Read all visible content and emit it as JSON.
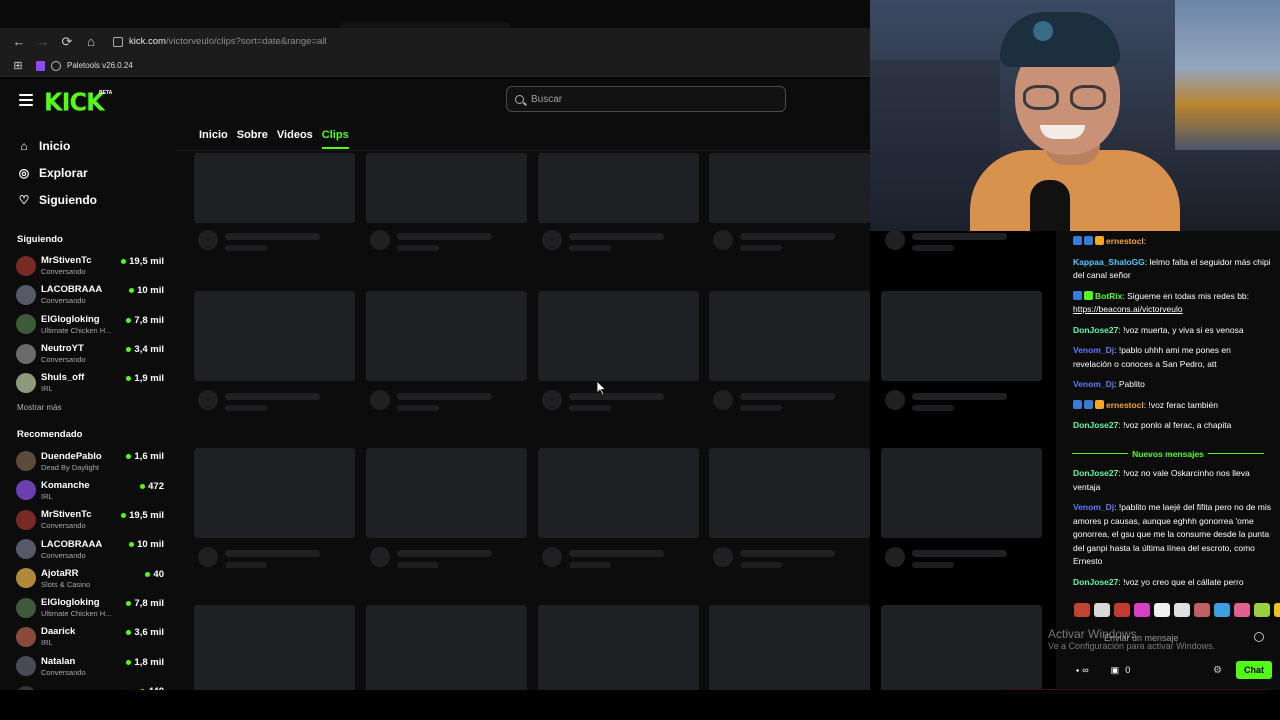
{
  "browser": {
    "url_host": "kick.com",
    "url_path": "/victorveulo/clips?sort=date&range=all",
    "bookmark": "Paletools v26.0.24"
  },
  "header": {
    "logo": "KICK",
    "logo_badge": "BETA",
    "search_placeholder": "Buscar"
  },
  "sidebar": {
    "nav": [
      {
        "label": "Inicio",
        "icon": "home-icon"
      },
      {
        "label": "Explorar",
        "icon": "compass-icon"
      },
      {
        "label": "Siguiendo",
        "icon": "heart-icon"
      }
    ],
    "following_title": "Siguiendo",
    "following": [
      {
        "name": "MrStivenTc",
        "category": "Conversando",
        "viewers": "19,5 mil",
        "color": "#7a2a24"
      },
      {
        "name": "LACOBRAAA",
        "category": "Conversando",
        "viewers": "10 mil",
        "color": "#555a66"
      },
      {
        "name": "ElGlogloking",
        "category": "Ultimate Chicken H...",
        "viewers": "7,8 mil",
        "color": "#3f5a3a"
      },
      {
        "name": "NeutroYT",
        "category": "Conversando",
        "viewers": "3,4 mil",
        "color": "#6b6b6b"
      },
      {
        "name": "Shuls_off",
        "category": "IRL",
        "viewers": "1,9 mil",
        "color": "#8a9a7a"
      }
    ],
    "show_more": "Mostrar más",
    "recommended_title": "Recomendado",
    "recommended": [
      {
        "name": "DuendePablo",
        "category": "Dead By Daylight",
        "viewers": "1,6 mil",
        "color": "#5c4a3a"
      },
      {
        "name": "Komanche",
        "category": "IRL",
        "viewers": "472",
        "color": "#6a3fb0"
      },
      {
        "name": "MrStivenTc",
        "category": "Conversando",
        "viewers": "19,5 mil",
        "color": "#7a2a24"
      },
      {
        "name": "LACOBRAAA",
        "category": "Conversando",
        "viewers": "10 mil",
        "color": "#555a66"
      },
      {
        "name": "AjotaRR",
        "category": "Slots & Casino",
        "viewers": "40",
        "color": "#b08a3a"
      },
      {
        "name": "ElGlogloking",
        "category": "Ultimate Chicken H...",
        "viewers": "7,8 mil",
        "color": "#3f5a3a"
      },
      {
        "name": "Daarick",
        "category": "IRL",
        "viewers": "3,6 mil",
        "color": "#8a4a3a"
      },
      {
        "name": "Natalan",
        "category": "Conversando",
        "viewers": "1,8 mil",
        "color": "#4a4a55"
      },
      {
        "name": "XANGLEE",
        "category": "",
        "viewers": "440",
        "color": "#333"
      }
    ]
  },
  "profile_tabs": [
    {
      "label": "Inicio",
      "active": false
    },
    {
      "label": "Sobre",
      "active": false
    },
    {
      "label": "Videos",
      "active": false
    },
    {
      "label": "Clips",
      "active": true
    }
  ],
  "chat": {
    "messages": [
      {
        "user": "ernestocl",
        "text": "",
        "user_color": "#f5a623",
        "badges": [
          "#3a7bd5",
          "#3a7bd5",
          "#f5a623"
        ]
      },
      {
        "user": "Kappaa_ShaloGG",
        "text": "lelmo falta el seguidor más chipi del canal señor",
        "user_color": "#53c8fc",
        "badges": []
      },
      {
        "user": "BotRix",
        "text": "Sigueme en todas mis redes bb: ",
        "link": "https://beacons.ai/victorveulo",
        "user_color": "#53fc18",
        "badges": [
          "#3a7bd5",
          "#53fc18"
        ]
      },
      {
        "user": "DonJose27",
        "text": "!voz muerta, y viva si es venosa",
        "user_color": "#53fcb0",
        "badges": []
      },
      {
        "user": "Venom_Dj",
        "text": "!pablo uhhh ami me pones en revelación o conoces a San Pedro, att",
        "user_color": "#5b7cfa",
        "badges": []
      },
      {
        "user": "Venom_Dj",
        "text": "Pablito",
        "user_color": "#5b7cfa",
        "badges": []
      },
      {
        "user": "ernestocl",
        "text": "!voz ferac también",
        "user_color": "#f5a623",
        "badges": [
          "#3a7bd5",
          "#3a7bd5",
          "#f5a623"
        ]
      },
      {
        "user": "DonJose27",
        "text": "!voz ponlo al ferac, a chapita",
        "user_color": "#53fcb0",
        "badges": []
      }
    ],
    "new_messages_label": "Nuevos mensajes",
    "messages2": [
      {
        "user": "DonJose27",
        "text": "!voz no vale Oskarcinho nos lleva ventaja",
        "user_color": "#53fcb0"
      },
      {
        "user": "Venom_Dj",
        "text": "!pablito me laejé del fifita pero no de mis amores p causas, aunque eghhh gonorrea 'ome gonorrea, el gsu que me la consume desde la punta del ganpi hasta la última línea del escroto, como Ernesto",
        "user_color": "#5b7cfa"
      },
      {
        "user": "DonJose27",
        "text": "!voz yo creo que el cállate perro",
        "user_color": "#53fcb0"
      }
    ],
    "emote_colors": [
      "#c0442f",
      "#d8d8d8",
      "#c23b2e",
      "#d640c7",
      "#f0f0f0",
      "#e0e0e0",
      "#c06060",
      "#3aa0e0",
      "#e06090",
      "#9ad040",
      "#f0c020",
      "#e03030"
    ],
    "input_placeholder": "Enviar un mensaje",
    "points": "∞",
    "store_count": "0",
    "chat_button": "Chat"
  },
  "watermark": {
    "title": "Activar Windows",
    "sub": "Ve a Configuración para activar Windows."
  }
}
